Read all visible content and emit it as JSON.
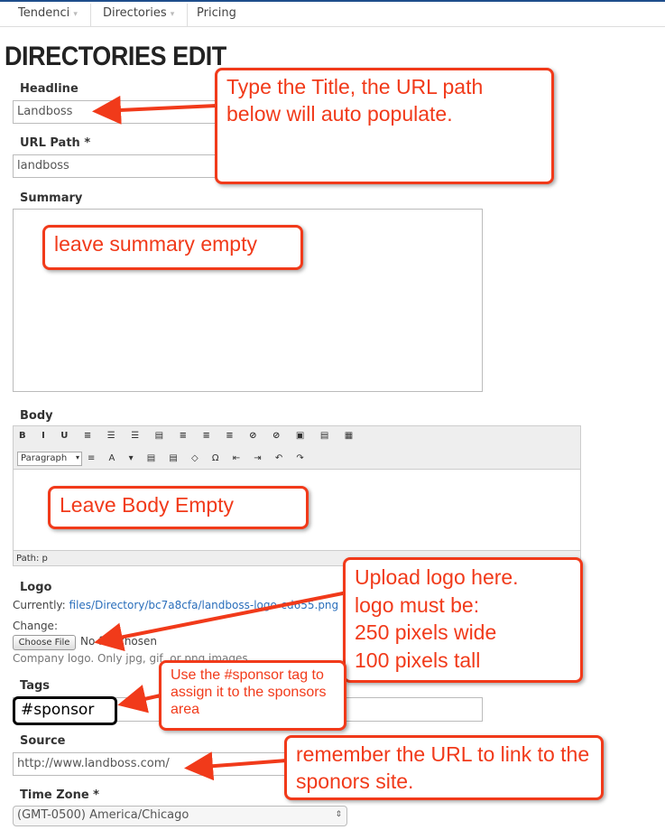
{
  "nav": {
    "items": [
      {
        "label": "Tendenci",
        "caret": "▾"
      },
      {
        "label": "Directories",
        "caret": "▾"
      },
      {
        "label": "Pricing"
      }
    ]
  },
  "page_title": "DIRECTORIES EDIT",
  "form": {
    "headline": {
      "label": "Headline",
      "value": "Landboss"
    },
    "url_path": {
      "label": "URL Path *",
      "value": "landboss"
    },
    "summary": {
      "label": "Summary",
      "value": ""
    },
    "body": {
      "label": "Body",
      "format_select": "Paragraph",
      "path_text": "Path: p"
    },
    "logo": {
      "label": "Logo",
      "currently_label": "Currently:",
      "currently_link": "files/Directory/bc7a8cfa/landboss-logo-cd655.png",
      "change_label": "Change:",
      "choose_button": "Choose File",
      "file_status": "No file chosen",
      "help": "Company logo. Only jpg, gif, or png images."
    },
    "tags": {
      "label": "Tags",
      "value": "#sponsor"
    },
    "source": {
      "label": "Source",
      "value": "http://www.landboss.com/"
    },
    "time_zone": {
      "label": "Time Zone *",
      "value": "(GMT-0500) America/Chicago"
    }
  },
  "callouts": {
    "title": "Type the Title, the URL path below will auto populate.",
    "summary": "leave summary empty",
    "body": "Leave Body Empty",
    "logo": [
      "Upload logo here.",
      "logo must be:",
      "250 pixels wide",
      "100 pixels tall"
    ],
    "tags": "Use the #sponsor tag to assign it to the sponsors area",
    "source": "remember the URL to link to the sponors site."
  },
  "colors": {
    "callout": "#f13a1a",
    "link": "#2a6ebb",
    "nav_top": "#1f4e8c"
  }
}
